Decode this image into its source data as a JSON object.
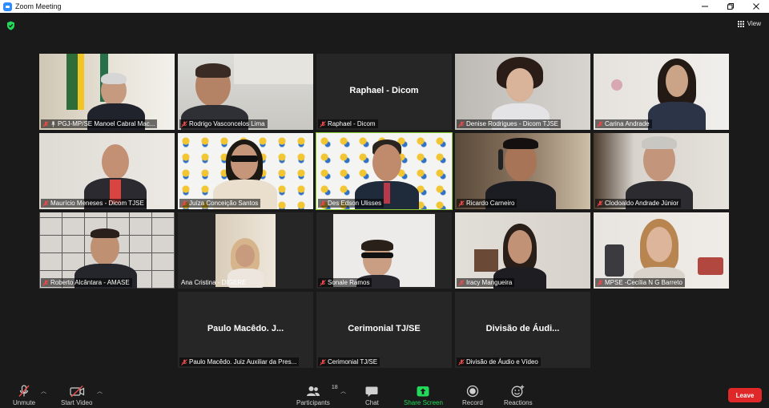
{
  "window": {
    "title": "Zoom Meeting"
  },
  "header": {
    "view_label": "View"
  },
  "tiles": [
    {
      "label": "PGJ-MP/SE Manoel Cabral Mac..."
    },
    {
      "label": "Rodrigo Vasconcelos Lima"
    },
    {
      "label": "Raphael - Dicom",
      "center_name": "Raphael - Dicom"
    },
    {
      "label": "Denise Rodrigues - Dicom TJSE"
    },
    {
      "label": "Carina Andrade"
    },
    {
      "label": "Maurício Meneses - Dicom TJSE"
    },
    {
      "label": "Juíza Conceição Santos"
    },
    {
      "label": "Des Edson Ulisses"
    },
    {
      "label": "Ricardo Carneiro"
    },
    {
      "label": "Clodoaldo Andrade Júnior"
    },
    {
      "label": "Roberto Alcântara - AMASE"
    },
    {
      "label": "Ana Cristina - DIGERE"
    },
    {
      "label": "Sonale Ramos"
    },
    {
      "label": "Iracy Mangueira"
    },
    {
      "label": "MPSE -Cecília N G Barreto"
    },
    {
      "label": "Paulo Macêdo. Juiz Auxiliar da Pres...",
      "center_name": "Paulo Macêdo. J..."
    },
    {
      "label": "Cerimonial TJ/SE",
      "center_name": "Cerimonial TJ/SE"
    },
    {
      "label": "Divisão de Áudio e Vídeo",
      "center_name": "Divisão de Áudi..."
    }
  ],
  "toolbar": {
    "unmute": "Unmute",
    "start_video": "Start Video",
    "participants": "Participants",
    "participants_count": "18",
    "chat": "Chat",
    "share_screen": "Share Screen",
    "record": "Record",
    "reactions": "Reactions",
    "leave": "Leave"
  },
  "colors": {
    "share_green": "#23d959",
    "leave_red": "#e02828",
    "active_speaker": "#8acb2f",
    "zoom_blue": "#2d8cff"
  }
}
